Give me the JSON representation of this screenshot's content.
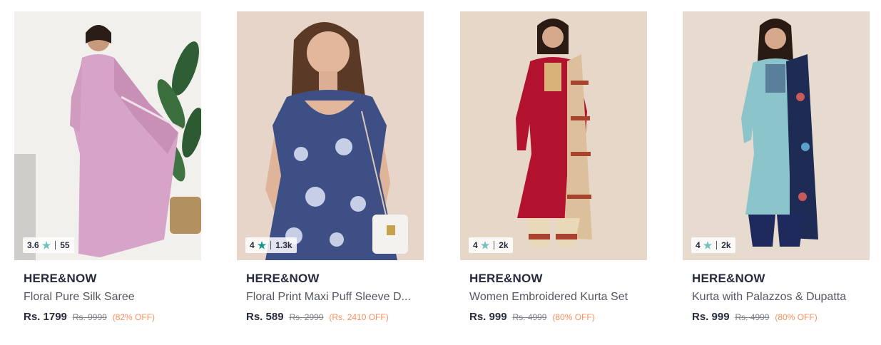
{
  "products": [
    {
      "brand": "HERE&NOW",
      "title": "Floral Pure Silk Saree",
      "rating": "3.6",
      "rating_count": "55",
      "star_color": "#72bfbc",
      "price": "Rs. 1799",
      "mrp": "Rs. 9999",
      "discount": "(82% OFF)"
    },
    {
      "brand": "HERE&NOW",
      "title": "Floral Print Maxi Puff Sleeve D...",
      "rating": "4",
      "rating_count": "1.3k",
      "star_color": "#14958f",
      "price": "Rs. 589",
      "mrp": "Rs. 2999",
      "discount": "(Rs. 2410 OFF)"
    },
    {
      "brand": "HERE&NOW",
      "title": "Women Embroidered Kurta Set",
      "rating": "4",
      "rating_count": "2k",
      "star_color": "#72bfbc",
      "price": "Rs. 999",
      "mrp": "Rs. 4999",
      "discount": "(80% OFF)"
    },
    {
      "brand": "HERE&NOW",
      "title": "Kurta with Palazzos & Dupatta",
      "rating": "4",
      "rating_count": "2k",
      "star_color": "#72bfbc",
      "price": "Rs. 999",
      "mrp": "Rs. 4999",
      "discount": "(80% OFF)"
    }
  ],
  "icons": {
    "rating_star": "star-icon"
  }
}
